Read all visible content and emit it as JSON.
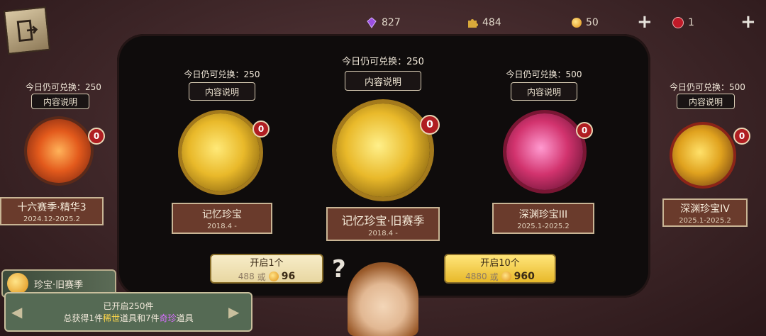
{
  "currency": {
    "gems": "827",
    "puzzle": "484",
    "coins": "50",
    "red_token": "1"
  },
  "cards": [
    {
      "quota": "今日仍可兑换：250",
      "info": "内容说明",
      "badge": "0",
      "title": "十六赛季·精华3",
      "dates": "2024.12-2025.2"
    },
    {
      "quota": "今日仍可兑换：250",
      "info": "内容说明",
      "badge": "0",
      "title": "记忆珍宝",
      "dates": "2018.4 -"
    },
    {
      "quota": "今日仍可兑换：250",
      "info": "内容说明",
      "badge": "0",
      "title": "记忆珍宝·旧赛季",
      "dates": "2018.4 -"
    },
    {
      "quota": "今日仍可兑换：500",
      "info": "内容说明",
      "badge": "0",
      "title": "深渊珍宝III",
      "dates": "2025.1-2025.2"
    },
    {
      "quota": "今日仍可兑换：500",
      "info": "内容说明",
      "badge": "0",
      "title": "深渊珍宝IV",
      "dates": "2025.1-2025.2"
    }
  ],
  "open_one": {
    "label": "开启1个",
    "cost_a": "488",
    "or": "或",
    "cost_b": "96"
  },
  "open_ten": {
    "label": "开启10个",
    "cost_a": "4880",
    "or": "或",
    "cost_b": "960"
  },
  "series_tab": "珍宝·旧赛季",
  "summary": {
    "line1": "已开启250件",
    "line2_a": "总获得1件",
    "line2_rare": "稀世",
    "line2_b": "道具和7件",
    "line2_epic": "奇珍",
    "line2_c": "道具"
  },
  "colors": {
    "gold": "#e9b92a",
    "pink": "#d2336e",
    "orange": "#e35a1c",
    "badge": "#b01e22"
  }
}
